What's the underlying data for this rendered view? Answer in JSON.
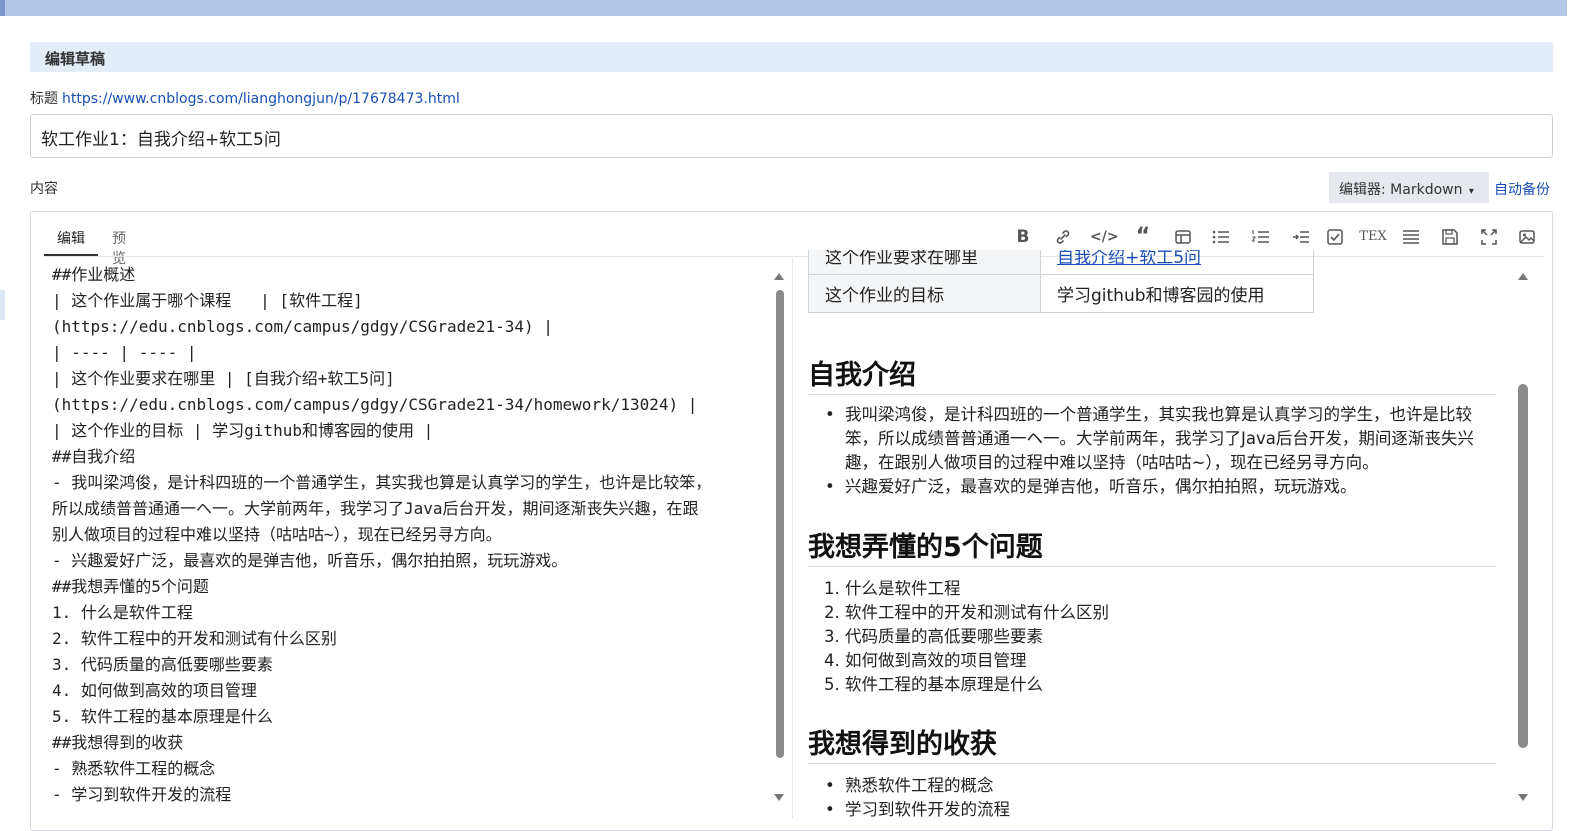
{
  "section_header": "编辑草稿",
  "title_label": "标题",
  "title_link": "https://www.cnblogs.com/lianghongjun/p/17678473.html",
  "title_value": "软工作业1：自我介绍+软工5问",
  "content_label": "内容",
  "editor_select": "编辑器: Markdown",
  "autosave": "自动备份",
  "tabs": {
    "edit": "编辑",
    "preview": "预览"
  },
  "toolbar_icons": [
    "bold-icon",
    "link-icon",
    "code-icon",
    "quote-icon",
    "table-icon",
    "unordered-list-icon",
    "ordered-list-icon",
    "indent-icon",
    "checkbox-icon",
    "tex-icon",
    "justify-icon",
    "save-icon",
    "fullscreen-icon",
    "image-icon"
  ],
  "source_lines": [
    "##作业概述",
    "| 这个作业属于哪个课程   | [软件工程]",
    "(https://edu.cnblogs.com/campus/gdgy/CSGrade21-34) |",
    "| ---- | ---- |",
    "| 这个作业要求在哪里 | [自我介绍+软工5问]",
    "(https://edu.cnblogs.com/campus/gdgy/CSGrade21-34/homework/13024) |",
    "| 这个作业的目标 | 学习github和博客园的使用 |",
    "##自我介绍",
    "- 我叫梁鸿俊，是计科四班的一个普通学生，其实我也算是认真学习的学生，也许是比较笨，",
    "所以成绩普普通通一ヘ一。大学前两年，我学习了Java后台开发，期间逐渐丧失兴趣，在跟",
    "别人做项目的过程中难以坚持（咕咕咕~），现在已经另寻方向。",
    "- 兴趣爱好广泛，最喜欢的是弹吉他，听音乐，偶尔拍拍照，玩玩游戏。",
    "##我想弄懂的5个问题",
    "1. 什么是软件工程",
    "2. 软件工程中的开发和测试有什么区别",
    "3. 代码质量的高低要哪些要素",
    "4. 如何做到高效的项目管理",
    "5. 软件工程的基本原理是什么",
    "##我想得到的收获",
    "- 熟悉软件工程的概念",
    "- 学习到软件开发的流程"
  ],
  "preview": {
    "table_rows": [
      {
        "c1": "这个作业要求在哪里",
        "c2": "自我介绍+软工5问"
      },
      {
        "c1": "这个作业的目标",
        "c2": "学习github和博客园的使用"
      }
    ],
    "h_intro": "自我介绍",
    "intro_items": [
      "我叫梁鸿俊，是计科四班的一个普通学生，其实我也算是认真学习的学生，也许是比较笨，所以成绩普普通通一ヘ一。大学前两年，我学习了Java后台开发，期间逐渐丧失兴趣，在跟别人做项目的过程中难以坚持（咕咕咕~），现在已经另寻方向。",
      "兴趣爱好广泛，最喜欢的是弹吉他，听音乐，偶尔拍拍照，玩玩游戏。"
    ],
    "h_questions": "我想弄懂的5个问题",
    "questions": [
      "什么是软件工程",
      "软件工程中的开发和测试有什么区别",
      "代码质量的高低要哪些要素",
      "如何做到高效的项目管理",
      "软件工程的基本原理是什么"
    ],
    "h_gains": "我想得到的收获",
    "gains": [
      "熟悉软件工程的概念",
      "学习到软件开发的流程"
    ]
  }
}
